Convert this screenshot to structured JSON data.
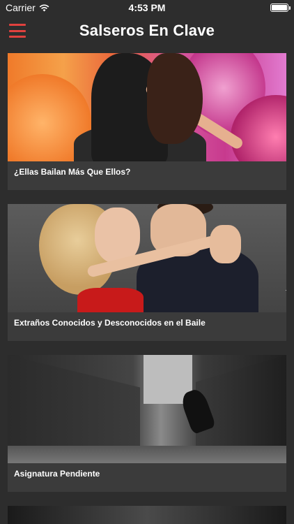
{
  "status_bar": {
    "carrier": "Carrier",
    "time": "4:53 PM"
  },
  "nav": {
    "title": "Salseros En Clave"
  },
  "colors": {
    "background": "#2d2d2d",
    "card": "#3b3b3b",
    "accent": "#e0413e",
    "text": "#ffffff"
  },
  "articles": [
    {
      "title": "¿Ellas Bailan Más Que Ellos?",
      "image": "woman-dancing-flowers"
    },
    {
      "title": "Extraños Conocidos y Desconocidos en el Baile",
      "image": "couple-dancing",
      "watermark": "ography"
    },
    {
      "title": "Asignatura Pendiente",
      "image": "alley-jump"
    },
    {
      "title": "",
      "image": "dancers-partial"
    }
  ]
}
